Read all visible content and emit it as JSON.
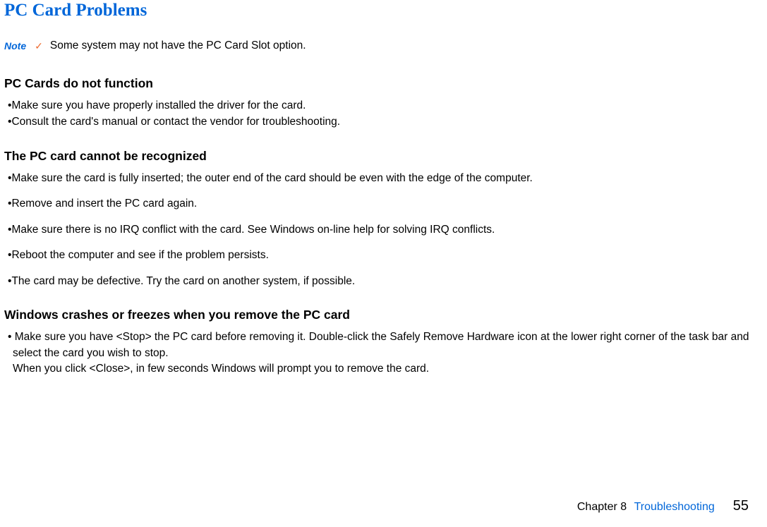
{
  "title": "PC Card Problems",
  "note": {
    "label": "Note",
    "text": "Some system may not have the PC Card Slot option."
  },
  "sections": {
    "s1": {
      "heading": "PC Cards do not function",
      "items": [
        "Make sure you have properly installed the driver for the card.",
        "Consult the card's manual or contact the vendor for troubleshooting."
      ]
    },
    "s2": {
      "heading": "The PC card cannot be recognized",
      "items": [
        "Make sure the card is fully inserted; the outer end of the card should be even with the edge of the computer.",
        "Remove and insert the PC card again.",
        "Make sure there is no IRQ conflict with the card. See Windows on-line help for solving IRQ conflicts.",
        "Reboot the computer and see if the problem persists.",
        "The card may be defective. Try the card on another system, if possible."
      ]
    },
    "s3": {
      "heading": "Windows crashes or freezes when you remove the PC card",
      "item_line1": "Make sure you have <Stop> the PC card before removing it. Double-click the Safely Remove Hardware icon at the lower right corner of the task bar and select the card you wish to stop.",
      "item_line2": "When you click <Close>, in few seconds Windows will prompt you to remove the card."
    }
  },
  "footer": {
    "chapter": "Chapter 8",
    "section": "Troubleshooting",
    "page": "55"
  }
}
